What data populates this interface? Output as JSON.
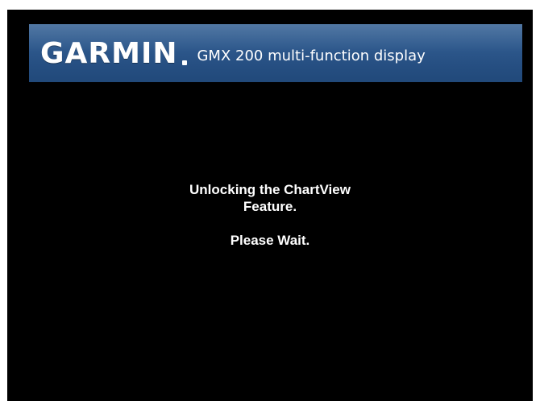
{
  "header": {
    "brand": "GARMIN",
    "product": "GMX 200 multi-function display"
  },
  "message": {
    "line1": "Unlocking the ChartView",
    "line2": "Feature.",
    "line3": "Please Wait."
  },
  "colors": {
    "screen_background": "#000000",
    "banner_top": "#3a6597",
    "banner_bottom": "#21497a",
    "text": "#ffffff"
  }
}
